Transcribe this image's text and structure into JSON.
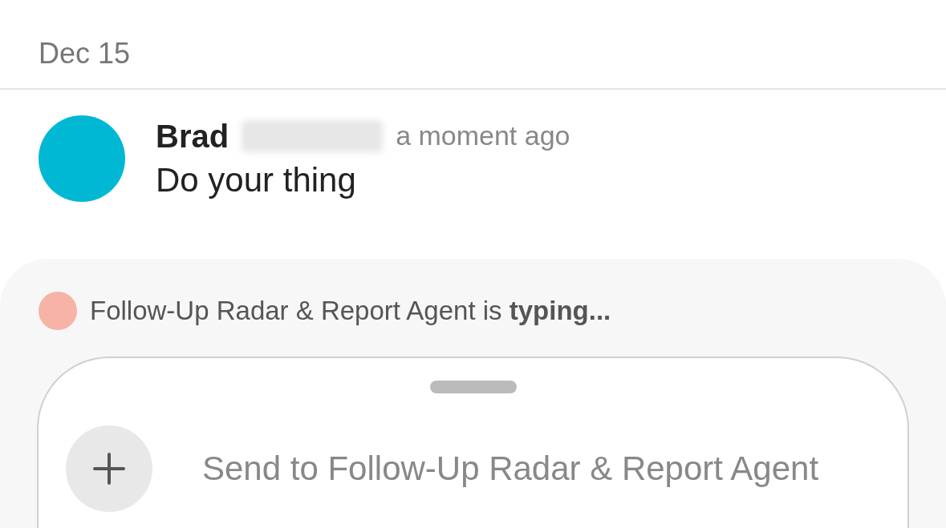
{
  "date_header": "Dec 15",
  "message": {
    "author": "Brad",
    "author_surname_redacted": true,
    "time": "a moment ago",
    "text": "Do your thing"
  },
  "typing_indicator": {
    "text": "Follow-Up Radar & Report Agent is **typing...**"
  },
  "composer": {
    "placeholder": "Send to Follow-Up Radar & Report Agent"
  }
}
